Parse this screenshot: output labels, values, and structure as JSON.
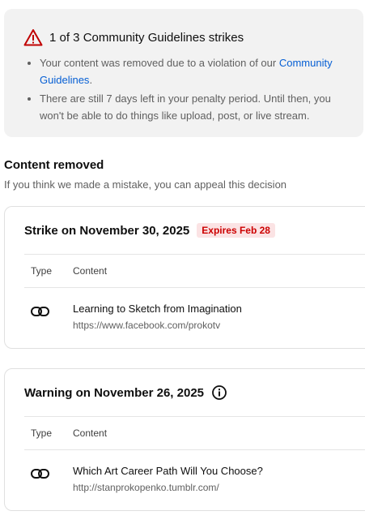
{
  "banner": {
    "title": "1 of 3 Community Guidelines strikes",
    "bullet1_text": "Your content was removed due to a violation of our ",
    "bullet1_link": "Community Guidelines",
    "bullet1_end": ".",
    "bullet2": "There are still 7 days left in your penalty period. Until then, you won't be able to do things like upload, post, or live stream."
  },
  "section": {
    "title": "Content removed",
    "subtitle": "If you think we made a mistake, you can appeal this decision"
  },
  "strike_card": {
    "title": "Strike on November 30, 2025",
    "badge": "Expires Feb 28",
    "col_type": "Type",
    "col_content": "Content",
    "item_title": "Learning to Sketch from Imagination",
    "item_url": "https://www.facebook.com/prokotv",
    "item_icon": "link-icon"
  },
  "warning_card": {
    "title": "Warning on November 26, 2025",
    "col_type": "Type",
    "col_content": "Content",
    "item_title": "Which Art Career Path Will You Choose?",
    "item_url": "http://stanprokopenko.tumblr.com/",
    "item_icon": "link-icon"
  },
  "colors": {
    "banner_bg": "#f2f2f2",
    "link": "#065fd4",
    "badge_bg": "#fbe3e4",
    "badge_text": "#cc0000",
    "warning_icon": "#c00000"
  }
}
